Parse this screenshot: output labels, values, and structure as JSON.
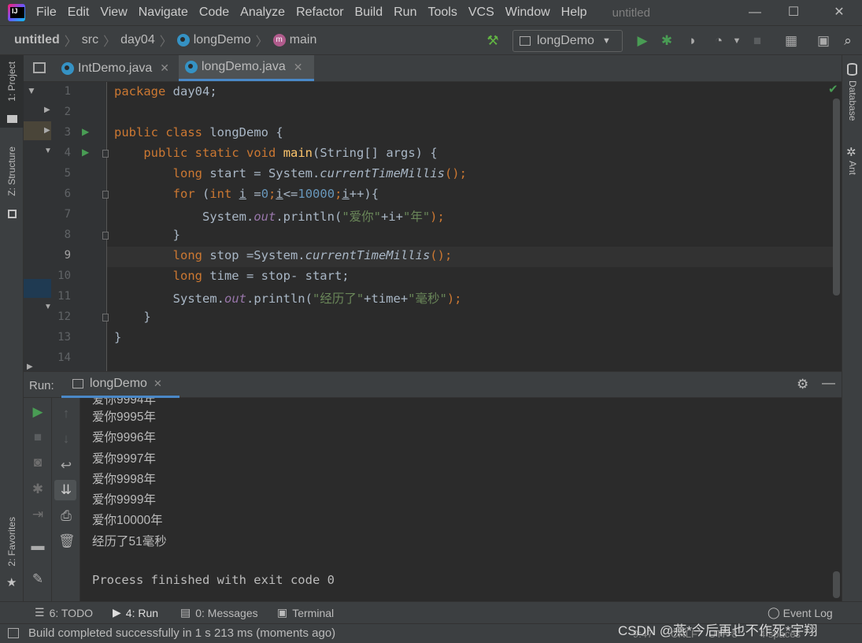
{
  "window": {
    "title": "untitled"
  },
  "menu": [
    "File",
    "Edit",
    "View",
    "Navigate",
    "Code",
    "Analyze",
    "Refactor",
    "Build",
    "Run",
    "Tools",
    "VCS",
    "Window",
    "Help"
  ],
  "breadcrumb": {
    "project": "untitled",
    "folder1": "src",
    "folder2": "day04",
    "class_name": "longDemo",
    "method": "main"
  },
  "toolbar": {
    "run_config": "longDemo"
  },
  "left_tools": {
    "project": "1: Project",
    "structure": "Z: Structure",
    "favorites": "2: Favorites"
  },
  "right_tools": {
    "database": "Database",
    "ant": "Ant"
  },
  "tabs": [
    {
      "label": "IntDemo.java"
    },
    {
      "label": "longDemo.java"
    }
  ],
  "line_numbers": [
    "1",
    "2",
    "3",
    "4",
    "5",
    "6",
    "7",
    "8",
    "9",
    "10",
    "11",
    "12",
    "13",
    "14"
  ],
  "code": {
    "l1": [
      "package",
      " day04;"
    ],
    "l3": [
      "public",
      " ",
      "class",
      " longDemo {"
    ],
    "l4": [
      "    ",
      "public",
      " ",
      "static",
      " ",
      "void",
      " ",
      "main",
      "(String[] args) {"
    ],
    "l5": [
      "        ",
      "long",
      " start = System.",
      "currentTimeMillis",
      "();"
    ],
    "l6": [
      "        ",
      "for",
      " (",
      "int",
      " ",
      "i",
      " =",
      "0",
      ";",
      "i",
      "<=",
      "10000",
      ";",
      "i",
      "++){"
    ],
    "l7": [
      "            System.",
      "out",
      ".println(",
      "\"爱你\"",
      "+i+",
      "\"年\"",
      ");"
    ],
    "l8": [
      "        }"
    ],
    "l9": [
      "        ",
      "long",
      " stop =System.",
      "currentTimeMillis",
      "();"
    ],
    "l10": [
      "        ",
      "long",
      " time = stop- start;"
    ],
    "l11": [
      "        System.",
      "out",
      ".println(",
      "\"经历了\"",
      "+time+",
      "\"毫秒\"",
      ");"
    ],
    "l12": [
      "    }"
    ],
    "l13": [
      "}"
    ]
  },
  "run_panel": {
    "label": "Run:",
    "tab": "longDemo"
  },
  "console": [
    "爱你9995年",
    "爱你9996年",
    "爱你9997年",
    "爱你9998年",
    "爱你9999年",
    "爱你10000年",
    "经历了51毫秒",
    "Process finished with exit code 0"
  ],
  "bottom_tools": {
    "todo": "6: TODO",
    "run": "4: Run",
    "messages": "0: Messages",
    "terminal": "Terminal",
    "event_log": "Event Log"
  },
  "status": {
    "message": "Build completed successfully in 1 s 213 ms (moments ago)",
    "position": "9:47",
    "line_sep": "CRLF",
    "encoding": "UTF-8",
    "indent": "4 spaces",
    "watermark": "CSDN @燕*今后再也不作死*宇翔"
  },
  "colors": {
    "keyword": "#cc7832",
    "number": "#6897bb",
    "string": "#6a8759",
    "field": "#9876aa",
    "method_decl": "#ffc66d",
    "run_green": "#499c54",
    "accent": "#4a88c7"
  }
}
